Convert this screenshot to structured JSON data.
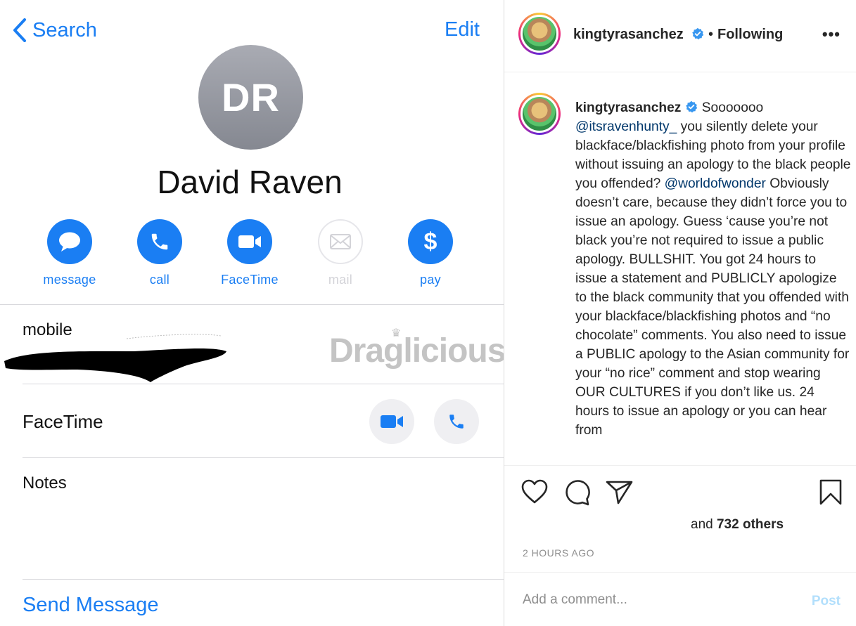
{
  "contact": {
    "nav": {
      "back_label": "Search",
      "edit_label": "Edit"
    },
    "avatar_initials": "DR",
    "name": "David Raven",
    "actions": [
      {
        "label": "message",
        "icon": "message-bubble-icon",
        "enabled": true
      },
      {
        "label": "call",
        "icon": "phone-icon",
        "enabled": true
      },
      {
        "label": "FaceTime",
        "icon": "video-camera-icon",
        "enabled": true
      },
      {
        "label": "mail",
        "icon": "envelope-icon",
        "enabled": false
      },
      {
        "label": "pay",
        "icon": "dollar-icon",
        "enabled": true
      }
    ],
    "mobile_label": "mobile",
    "watermark": "Draglicious",
    "facetime_label": "FaceTime",
    "notes_label": "Notes",
    "send_message_label": "Send Message",
    "accent_color": "#1a7ef3"
  },
  "post": {
    "username": "kingtyrasanchez",
    "separator": "•",
    "following_label": "Following",
    "more_label": "•••",
    "caption": {
      "username": "kingtyrasanchez",
      "opening": "Sooooooo",
      "mention1": "@itsravenhunty_",
      "part1": "you silently delete your blackface/blackfishing photo from your profile without issuing an apology to the black people you offended?",
      "mention2": "@worldofwonder",
      "part2": "Obviously doesn’t care, because they didn’t force you to issue an apology. Guess ‘cause you’re not black you’re not required to issue a public apology. BULLSHIT. You got 24 hours to issue a statement and PUBLICLY apologize to the black community that you offended with your blackface/blackfishing photos and “no chocolate” comments. You also need to issue a PUBLIC apology to the Asian community for your “no rice” comment and stop wearing OUR CULTURES if you don’t like us. 24 hours to issue an apology or you can hear from"
    },
    "likes_prefix": "and",
    "likes_count": "732 others",
    "timestamp": "2 HOURS AGO",
    "comment_placeholder": "Add a comment...",
    "post_button": "Post",
    "verified_color": "#3897f0"
  }
}
